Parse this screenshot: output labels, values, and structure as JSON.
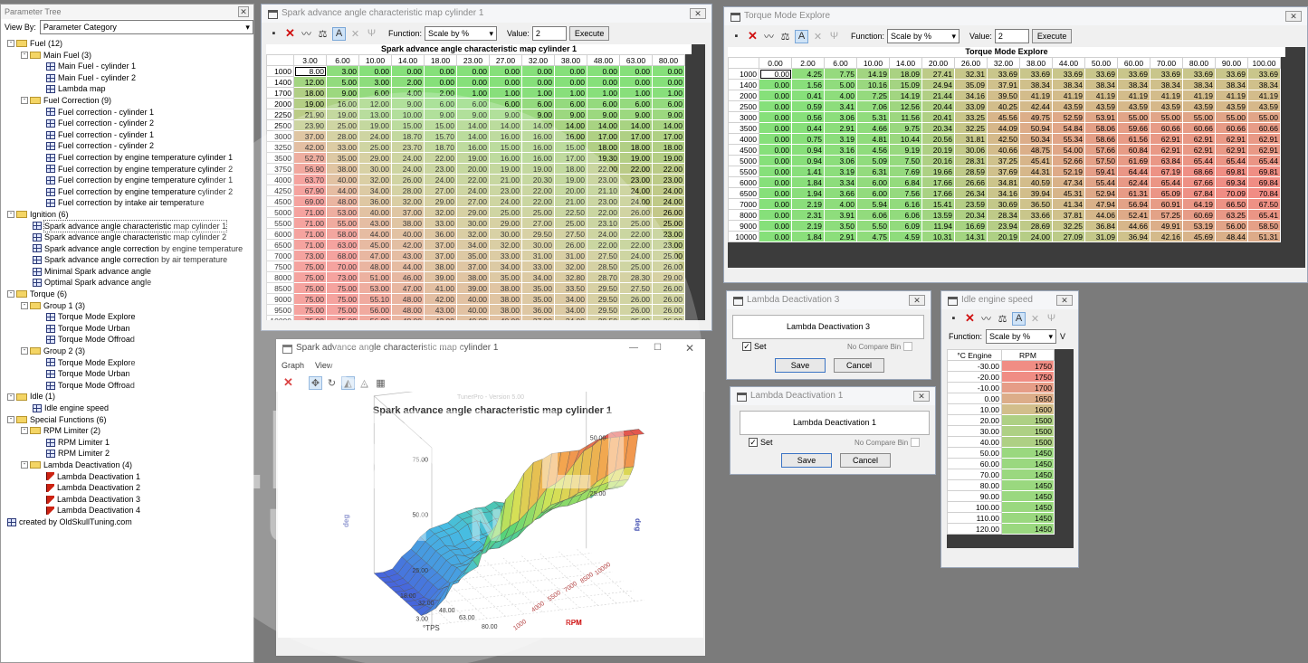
{
  "tree_panel": {
    "title": "Parameter Tree",
    "view_by_label": "View By:",
    "view_by_value": "Parameter Category",
    "nodes": [
      {
        "d": 0,
        "t": "f",
        "pm": "-",
        "label": "Fuel (12)"
      },
      {
        "d": 1,
        "t": "f",
        "pm": "-",
        "label": "Main Fuel (3)"
      },
      {
        "d": 2,
        "t": "g",
        "label": "Main Fuel - cylinder 1"
      },
      {
        "d": 2,
        "t": "g",
        "label": "Main Fuel - cylinder 2"
      },
      {
        "d": 2,
        "t": "g",
        "label": "Lambda map"
      },
      {
        "d": 1,
        "t": "f",
        "pm": "-",
        "label": "Fuel Correction (9)"
      },
      {
        "d": 2,
        "t": "g",
        "label": "Fuel correction - cylinder 1"
      },
      {
        "d": 2,
        "t": "g",
        "label": "Fuel correction - cylinder 2"
      },
      {
        "d": 2,
        "t": "g",
        "label": "Fuel correction - cylinder 1"
      },
      {
        "d": 2,
        "t": "g",
        "label": "Fuel correction - cylinder 2"
      },
      {
        "d": 2,
        "t": "g",
        "label": "Fuel correction by engine temperature cylinder 1"
      },
      {
        "d": 2,
        "t": "g",
        "label": "Fuel correction by engine temperature cylinder 2"
      },
      {
        "d": 2,
        "t": "g",
        "label": "Fuel correction by engine temperature cylinder 1"
      },
      {
        "d": 2,
        "t": "g",
        "label": "Fuel correction by engine temperature cylinder 2"
      },
      {
        "d": 2,
        "t": "g",
        "label": "Fuel correction by intake air temperature"
      },
      {
        "d": 0,
        "t": "f",
        "pm": "-",
        "label": "Ignition (6)"
      },
      {
        "d": 1,
        "t": "g",
        "label": "Spark advance angle characteristic map cylinder 1",
        "hl": true
      },
      {
        "d": 1,
        "t": "g",
        "label": "Spark advance angle characteristic map cylinder 2"
      },
      {
        "d": 1,
        "t": "g",
        "label": "Spark advance angle correction by engine temperature"
      },
      {
        "d": 1,
        "t": "g",
        "label": "Spark advance angle correction by air temperature"
      },
      {
        "d": 1,
        "t": "g",
        "label": "Minimal Spark advance angle"
      },
      {
        "d": 1,
        "t": "g",
        "label": "Optimal Spark advance angle"
      },
      {
        "d": 0,
        "t": "f",
        "pm": "-",
        "label": "Torque (6)"
      },
      {
        "d": 1,
        "t": "f",
        "pm": "-",
        "label": "Group 1 (3)"
      },
      {
        "d": 2,
        "t": "g",
        "label": "Torque Mode Explore"
      },
      {
        "d": 2,
        "t": "g",
        "label": "Torque Mode Urban"
      },
      {
        "d": 2,
        "t": "g",
        "label": "Torque Mode Offroad"
      },
      {
        "d": 1,
        "t": "f",
        "pm": "-",
        "label": "Group 2 (3)"
      },
      {
        "d": 2,
        "t": "g",
        "label": "Torque Mode Explore"
      },
      {
        "d": 2,
        "t": "g",
        "label": "Torque Mode Urban"
      },
      {
        "d": 2,
        "t": "g",
        "label": "Torque Mode Offroad"
      },
      {
        "d": 0,
        "t": "f",
        "pm": "-",
        "label": "Idle (1)"
      },
      {
        "d": 1,
        "t": "g",
        "label": "Idle engine speed"
      },
      {
        "d": 0,
        "t": "f",
        "pm": "-",
        "label": "Special Functions (6)"
      },
      {
        "d": 1,
        "t": "f",
        "pm": "-",
        "label": "RPM Limiter (2)"
      },
      {
        "d": 2,
        "t": "g",
        "label": "RPM Limiter 1"
      },
      {
        "d": 2,
        "t": "g",
        "label": "RPM Limiter 2"
      },
      {
        "d": 1,
        "t": "f",
        "pm": "-",
        "label": "Lambda Deactivation (4)"
      },
      {
        "d": 2,
        "t": "r",
        "label": "Lambda Deactivation 1"
      },
      {
        "d": 2,
        "t": "r",
        "label": "Lambda Deactivation 2"
      },
      {
        "d": 2,
        "t": "r",
        "label": "Lambda Deactivation 3"
      },
      {
        "d": 2,
        "t": "r",
        "label": "Lambda Deactivation 4"
      },
      {
        "d": 0,
        "t": "g",
        "label": "created by OldSkullTuning.com"
      }
    ]
  },
  "function_label": "Function:",
  "function_value": "Scale by %",
  "value_label": "Value:",
  "value_value": "2",
  "execute_label": "Execute",
  "spark_window": {
    "title": "Spark advance angle characteristic map cylinder 1",
    "grid_title": "Spark advance angle characteristic map cylinder 1",
    "cols": [
      "3.00",
      "6.00",
      "10.00",
      "14.00",
      "18.00",
      "23.00",
      "27.00",
      "32.00",
      "38.00",
      "48.00",
      "63.00",
      "80.00"
    ],
    "rows": [
      "1000",
      "1400",
      "1700",
      "2000",
      "2250",
      "2500",
      "3000",
      "3250",
      "3500",
      "3750",
      "4000",
      "4250",
      "4500",
      "5000",
      "5500",
      "6000",
      "6500",
      "7000",
      "7500",
      "8000",
      "8500",
      "9000",
      "9500",
      "10000"
    ],
    "values": [
      [
        8.0,
        3.0,
        0.0,
        0.0,
        0.0,
        0.0,
        0.0,
        0.0,
        0.0,
        0.0,
        0.0,
        0.0
      ],
      [
        12.0,
        5.0,
        3.0,
        2.0,
        0.0,
        0.0,
        0.0,
        0.0,
        0.0,
        0.0,
        0.0,
        0.0
      ],
      [
        18.0,
        9.0,
        6.0,
        4.0,
        2.0,
        1.0,
        1.0,
        1.0,
        1.0,
        1.0,
        1.0,
        1.0
      ],
      [
        19.0,
        16.0,
        12.0,
        9.0,
        6.0,
        6.0,
        6.0,
        6.0,
        6.0,
        6.0,
        6.0,
        6.0
      ],
      [
        21.9,
        19.0,
        13.0,
        10.0,
        9.0,
        9.0,
        9.0,
        9.0,
        9.0,
        9.0,
        9.0,
        9.0
      ],
      [
        23.9,
        25.0,
        19.0,
        15.0,
        15.0,
        14.0,
        14.0,
        14.0,
        14.0,
        14.0,
        14.0,
        14.0
      ],
      [
        37.0,
        28.0,
        24.0,
        18.7,
        15.7,
        14.0,
        16.0,
        16.0,
        16.0,
        17.0,
        17.0,
        17.0
      ],
      [
        42.0,
        33.0,
        25.0,
        23.7,
        18.7,
        16.0,
        15.0,
        16.0,
        15.0,
        18.0,
        18.0,
        18.0
      ],
      [
        52.7,
        35.0,
        29.0,
        24.0,
        22.0,
        19.0,
        16.0,
        16.0,
        17.0,
        19.3,
        19.0,
        19.0
      ],
      [
        56.9,
        38.0,
        30.0,
        24.0,
        23.0,
        20.0,
        19.0,
        19.0,
        18.0,
        22.0,
        22.0,
        22.0
      ],
      [
        63.7,
        40.0,
        32.0,
        26.0,
        24.0,
        22.0,
        21.0,
        20.3,
        19.0,
        23.0,
        23.0,
        23.0
      ],
      [
        67.9,
        44.0,
        34.0,
        28.0,
        27.0,
        24.0,
        23.0,
        22.0,
        20.0,
        21.1,
        24.0,
        24.0
      ],
      [
        69.0,
        48.0,
        36.0,
        32.0,
        29.0,
        27.0,
        24.0,
        22.0,
        21.0,
        23.0,
        24.0,
        24.0
      ],
      [
        71.0,
        53.0,
        40.0,
        37.0,
        32.0,
        29.0,
        25.0,
        25.0,
        22.5,
        22.0,
        26.0,
        26.0
      ],
      [
        71.0,
        55.0,
        43.0,
        38.0,
        33.0,
        30.0,
        29.0,
        27.0,
        25.0,
        23.1,
        25.0,
        25.0
      ],
      [
        71.0,
        58.0,
        44.0,
        40.0,
        36.0,
        32.0,
        30.0,
        29.5,
        27.5,
        24.0,
        22.0,
        23.0
      ],
      [
        71.0,
        63.0,
        45.0,
        42.0,
        37.0,
        34.0,
        32.0,
        30.0,
        26.0,
        22.0,
        22.0,
        23.0
      ],
      [
        73.0,
        68.0,
        47.0,
        43.0,
        37.0,
        35.0,
        33.0,
        31.0,
        31.0,
        27.5,
        24.0,
        25.0
      ],
      [
        75.0,
        70.0,
        48.0,
        44.0,
        38.0,
        37.0,
        34.0,
        33.0,
        32.0,
        28.5,
        25.0,
        26.0
      ],
      [
        75.0,
        73.0,
        51.0,
        46.0,
        39.0,
        38.0,
        35.0,
        34.0,
        32.8,
        28.7,
        28.3,
        29.0
      ],
      [
        75.0,
        75.0,
        53.0,
        47.0,
        41.0,
        39.0,
        38.0,
        35.0,
        33.5,
        29.5,
        27.5,
        26.0
      ],
      [
        75.0,
        75.0,
        55.1,
        48.0,
        42.0,
        40.0,
        38.0,
        35.0,
        34.0,
        29.5,
        26.0,
        26.0
      ],
      [
        75.0,
        75.0,
        56.0,
        48.0,
        43.0,
        40.0,
        38.0,
        36.0,
        34.0,
        29.5,
        26.0,
        26.0
      ],
      [
        75.0,
        75.0,
        56.0,
        48.0,
        43.0,
        40.0,
        40.0,
        37.0,
        34.0,
        29.5,
        25.0,
        26.0
      ]
    ]
  },
  "graph_window": {
    "title": "Spark advance angle characteristic map cylinder 1",
    "menu": [
      "Graph",
      "View"
    ],
    "watermark": "TunerPro - Version 5.00",
    "chart_title": "Spark advance angle characteristic map cylinder 1",
    "z_ticks": [
      "75.00",
      "50.00",
      "25.00",
      "3.00"
    ],
    "z_ticks_right": [
      "75.00",
      "50.00",
      "25.00"
    ],
    "z_label": "deg",
    "x_ticks": [
      "18.00",
      "32.00",
      "48.00",
      "63.00",
      "80.00"
    ],
    "x_label": "°TPS",
    "y_ticks": [
      "1000",
      "4000",
      "5500",
      "7000",
      "8500",
      "10000"
    ],
    "y_label": "RPM"
  },
  "torque_window": {
    "title": "Torque Mode Explore",
    "grid_title": "Torque Mode Explore",
    "cols": [
      "0.00",
      "2.00",
      "6.00",
      "10.00",
      "14.00",
      "20.00",
      "26.00",
      "32.00",
      "38.00",
      "44.00",
      "50.00",
      "60.00",
      "70.00",
      "80.00",
      "90.00",
      "100.00"
    ],
    "rows": [
      "1000",
      "1400",
      "2000",
      "2500",
      "3000",
      "3500",
      "4000",
      "4500",
      "5000",
      "5500",
      "6000",
      "6500",
      "7000",
      "8000",
      "9000",
      "10000"
    ],
    "values": [
      [
        0.0,
        4.25,
        7.75,
        14.19,
        18.09,
        27.41,
        32.31,
        33.69,
        33.69,
        33.69,
        33.69,
        33.69,
        33.69,
        33.69,
        33.69,
        33.69
      ],
      [
        0.0,
        1.56,
        5.0,
        10.16,
        15.09,
        24.94,
        35.09,
        37.91,
        38.34,
        38.34,
        38.34,
        38.34,
        38.34,
        38.34,
        38.34,
        38.34
      ],
      [
        0.0,
        0.41,
        4.0,
        7.25,
        14.19,
        21.44,
        34.16,
        39.5,
        41.19,
        41.19,
        41.19,
        41.19,
        41.19,
        41.19,
        41.19,
        41.19
      ],
      [
        0.0,
        0.59,
        3.41,
        7.06,
        12.56,
        20.44,
        33.09,
        40.25,
        42.44,
        43.59,
        43.59,
        43.59,
        43.59,
        43.59,
        43.59,
        43.59
      ],
      [
        0.0,
        0.56,
        3.06,
        5.31,
        11.56,
        20.41,
        33.25,
        45.56,
        49.75,
        52.59,
        53.91,
        55.0,
        55.0,
        55.0,
        55.0,
        55.0
      ],
      [
        0.0,
        0.44,
        2.91,
        4.66,
        9.75,
        20.34,
        32.25,
        44.09,
        50.94,
        54.84,
        58.06,
        59.66,
        60.66,
        60.66,
        60.66,
        60.66
      ],
      [
        0.0,
        0.75,
        3.19,
        4.81,
        10.44,
        20.56,
        31.81,
        42.5,
        50.34,
        55.34,
        58.66,
        61.56,
        62.91,
        62.91,
        62.91,
        62.91
      ],
      [
        0.0,
        0.94,
        3.16,
        4.56,
        9.19,
        20.19,
        30.06,
        40.66,
        48.75,
        54.0,
        57.66,
        60.84,
        62.91,
        62.91,
        62.91,
        62.91
      ],
      [
        0.0,
        0.94,
        3.06,
        5.09,
        7.5,
        20.16,
        28.31,
        37.25,
        45.41,
        52.66,
        57.5,
        61.69,
        63.84,
        65.44,
        65.44,
        65.44
      ],
      [
        0.0,
        1.41,
        3.19,
        6.31,
        7.69,
        19.66,
        28.59,
        37.69,
        44.31,
        52.19,
        59.41,
        64.44,
        67.19,
        68.66,
        69.81,
        69.81
      ],
      [
        0.0,
        1.84,
        3.34,
        6.0,
        6.84,
        17.66,
        26.66,
        34.81,
        40.59,
        47.34,
        55.44,
        62.44,
        65.44,
        67.66,
        69.34,
        69.84
      ],
      [
        0.0,
        1.94,
        3.66,
        6.0,
        7.56,
        17.66,
        26.34,
        34.16,
        39.94,
        45.31,
        52.94,
        61.31,
        65.09,
        67.84,
        70.09,
        70.84
      ],
      [
        0.0,
        2.19,
        4.0,
        5.94,
        6.16,
        15.41,
        23.59,
        30.69,
        36.5,
        41.34,
        47.94,
        56.94,
        60.91,
        64.19,
        66.5,
        67.5
      ],
      [
        0.0,
        2.31,
        3.91,
        6.06,
        6.06,
        13.59,
        20.34,
        28.34,
        33.66,
        37.81,
        44.06,
        52.41,
        57.25,
        60.69,
        63.25,
        65.41
      ],
      [
        0.0,
        2.19,
        3.5,
        5.5,
        6.09,
        11.94,
        16.69,
        23.94,
        28.69,
        32.25,
        36.84,
        44.66,
        49.91,
        53.19,
        56.0,
        58.5
      ],
      [
        0.0,
        1.84,
        2.91,
        4.75,
        4.59,
        10.31,
        14.31,
        20.19,
        24.0,
        27.09,
        31.09,
        36.94,
        42.16,
        45.69,
        48.44,
        51.31
      ]
    ]
  },
  "lambda3": {
    "title": "Lambda Deactivation 3",
    "name": "Lambda Deactivation 3",
    "set_label": "Set",
    "ncb_label": "No Compare Bin",
    "save": "Save",
    "cancel": "Cancel"
  },
  "lambda1": {
    "title": "Lambda Deactivation 1",
    "name": "Lambda Deactivation 1",
    "set_label": "Set",
    "ncb_label": "No Compare Bin",
    "save": "Save",
    "cancel": "Cancel"
  },
  "idle_window": {
    "title": "Idle engine speed",
    "col_header_left": "°C Engine",
    "col_header_right": "RPM",
    "extra": "V",
    "rows": [
      "-30.00",
      "-20.00",
      "-10.00",
      "0.00",
      "10.00",
      "20.00",
      "30.00",
      "40.00",
      "50.00",
      "60.00",
      "70.00",
      "80.00",
      "90.00",
      "100.00",
      "110.00",
      "120.00"
    ],
    "values": [
      1750,
      1750,
      1700,
      1650,
      1600,
      1500,
      1500,
      1500,
      1450,
      1450,
      1450,
      1450,
      1450,
      1450,
      1450,
      1450
    ]
  },
  "watermark_text": {
    "big": "OLDSKULL",
    "sub": "TUNING",
    "oo": "OO"
  },
  "colors": {
    "green": "#86e07a",
    "yellow": "#c9c27a",
    "red": "#f08a84",
    "select": "#dfe6ff"
  }
}
